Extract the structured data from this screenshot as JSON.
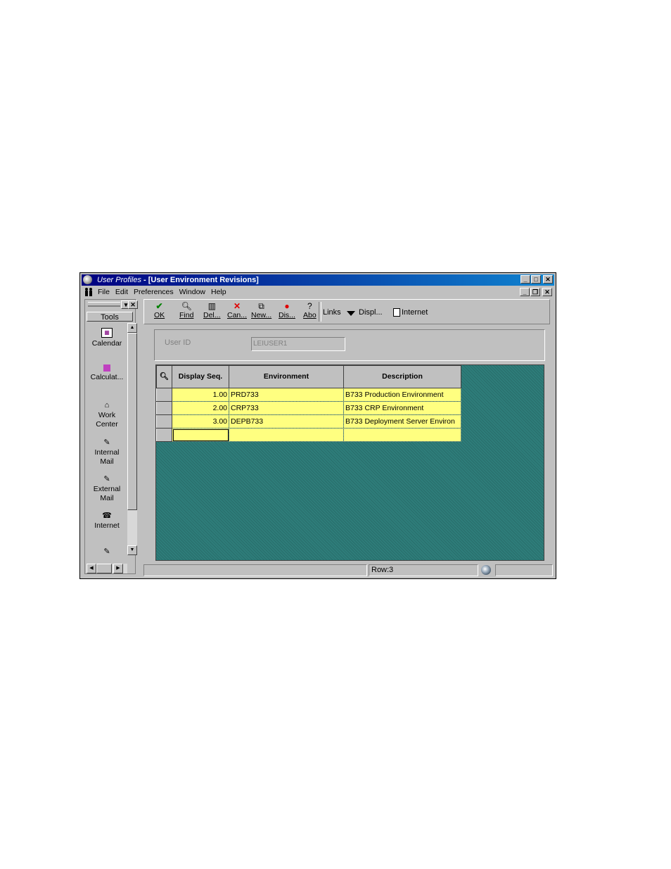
{
  "window": {
    "title_app": "User Profiles",
    "title_separator": " - ",
    "title_form": "[User Environment Revisions]",
    "buttons": {
      "minimize": "_",
      "maximize": "□",
      "close": "✕"
    }
  },
  "menubar": {
    "items": [
      "File",
      "Edit",
      "Preferences",
      "Window",
      "Help"
    ],
    "mdi_buttons": {
      "minimize": "_",
      "restore": "❐",
      "close": "✕"
    }
  },
  "sidebar": {
    "header": "Tools",
    "items": [
      {
        "label": "Calendar",
        "icon": "calendar-icon"
      },
      {
        "label": "Calculat...",
        "icon": "calculator-icon"
      },
      {
        "label": "Work Center",
        "icon": "work-center-icon"
      },
      {
        "label": "Internal Mail",
        "icon": "internal-mail-icon"
      },
      {
        "label": "External Mail",
        "icon": "external-mail-icon"
      },
      {
        "label": "Internet",
        "icon": "internet-icon"
      }
    ]
  },
  "toolbar": {
    "ok": "OK",
    "find": "Find",
    "delete": "Del...",
    "cancel": "Can...",
    "new": "New...",
    "display": "Dis...",
    "about": "Abo",
    "links": "Links",
    "displ_menu": "Displ...",
    "internet": "Internet"
  },
  "form": {
    "user_id_label": "User ID",
    "user_id_value": "LEIUSER1"
  },
  "grid": {
    "columns": [
      "Display Seq.",
      "Environment",
      "Description"
    ],
    "rows": [
      {
        "seq": "1.00",
        "env": "PRD733",
        "desc": "B733 Production Environment"
      },
      {
        "seq": "2.00",
        "env": "CRP733",
        "desc": "B733 CRP Environment"
      },
      {
        "seq": "3.00",
        "env": "DEPB733",
        "desc": "B733 Deployment Server Environ"
      }
    ]
  },
  "status": {
    "row": "Row:3"
  },
  "colors": {
    "titlebar": "#000080",
    "grid_bg": "#2e7d7a",
    "row_fill": "#ffff80"
  }
}
